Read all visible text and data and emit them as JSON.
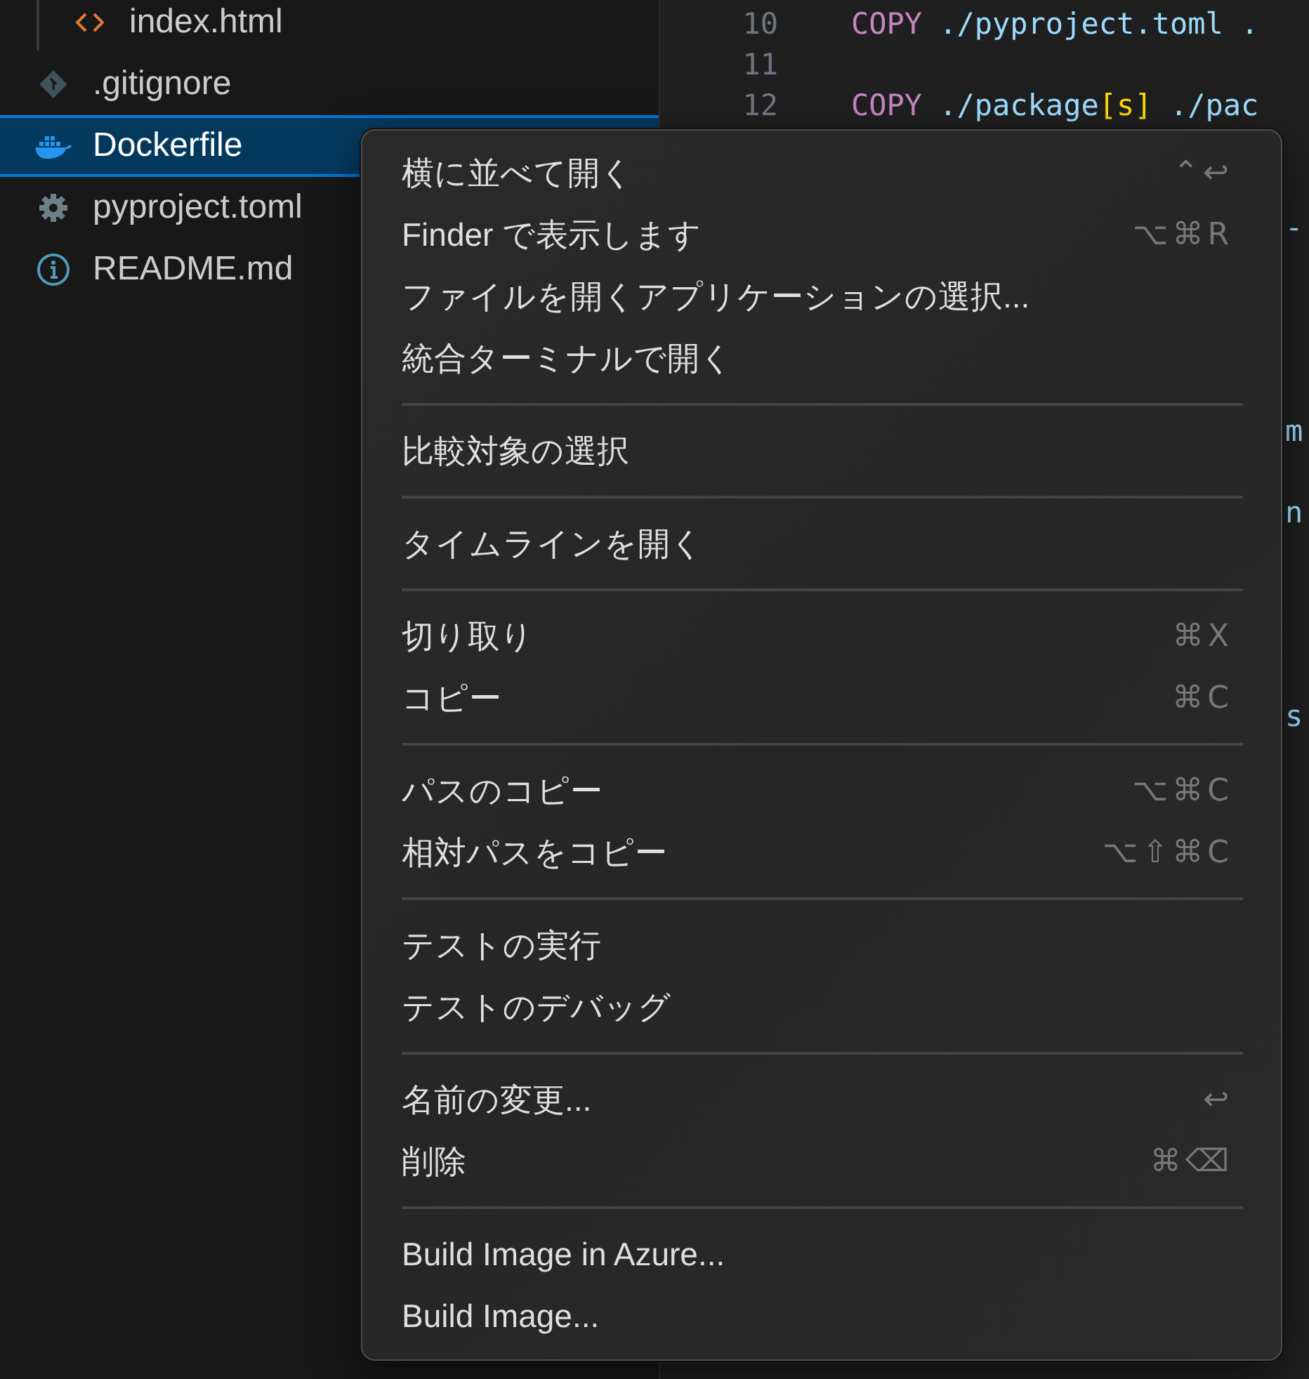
{
  "explorer": {
    "items": [
      {
        "label": "index.html",
        "selected": false,
        "nested": true
      },
      {
        "label": ".gitignore",
        "selected": false,
        "nested": false
      },
      {
        "label": "Dockerfile",
        "selected": true,
        "nested": false
      },
      {
        "label": "pyproject.toml",
        "selected": false,
        "nested": false
      },
      {
        "label": "README.md",
        "selected": false,
        "nested": false
      }
    ]
  },
  "editor": {
    "lines": [
      {
        "kind": "code",
        "number": "10",
        "tokens": [
          {
            "kind": "keyword",
            "text": "COPY"
          },
          {
            "kind": "path",
            "text": "./pyproject.toml ."
          }
        ]
      },
      {
        "kind": "code",
        "number": "11"
      },
      {
        "kind": "code",
        "number": "12",
        "tokens": [
          {
            "kind": "keyword",
            "text": "COPY"
          },
          {
            "kind": "path",
            "text": "./package"
          },
          {
            "kind": "bracket",
            "text": "[s]"
          },
          {
            "kind": "path",
            "text": " ./pac"
          }
        ]
      },
      {
        "kind": "blank"
      },
      {
        "kind": "blank"
      },
      {
        "kind": "clipped",
        "text": "-"
      },
      {
        "kind": "blank"
      },
      {
        "kind": "blank"
      },
      {
        "kind": "blank"
      },
      {
        "kind": "blank"
      },
      {
        "kind": "clipped",
        "text": "m"
      },
      {
        "kind": "blank"
      },
      {
        "kind": "clipped",
        "text": "n"
      },
      {
        "kind": "blank"
      },
      {
        "kind": "blank"
      },
      {
        "kind": "blank"
      },
      {
        "kind": "blank"
      },
      {
        "kind": "clipped",
        "text": "s"
      }
    ]
  },
  "context_menu": {
    "groups": [
      [
        {
          "label": "横に並べて開く",
          "shortcut": "⌃↩"
        },
        {
          "label": "Finder で表示します",
          "shortcut": "⌥⌘R"
        },
        {
          "label": "ファイルを開くアプリケーションの選択..."
        },
        {
          "label": "統合ターミナルで開く"
        }
      ],
      [
        {
          "label": "比較対象の選択"
        }
      ],
      [
        {
          "label": "タイムラインを開く"
        }
      ],
      [
        {
          "label": "切り取り",
          "shortcut": "⌘X"
        },
        {
          "label": "コピー",
          "shortcut": "⌘C"
        }
      ],
      [
        {
          "label": "パスのコピー",
          "shortcut": "⌥⌘C"
        },
        {
          "label": "相対パスをコピー",
          "shortcut": "⌥⇧⌘C"
        }
      ],
      [
        {
          "label": "テストの実行"
        },
        {
          "label": "テストのデバッグ"
        }
      ],
      [
        {
          "label": "名前の変更...",
          "shortcut": "↩"
        },
        {
          "label": "削除",
          "shortcut": "⌘⌫"
        }
      ],
      [
        {
          "label": "Build Image in Azure..."
        },
        {
          "label": "Build Image..."
        }
      ]
    ]
  }
}
